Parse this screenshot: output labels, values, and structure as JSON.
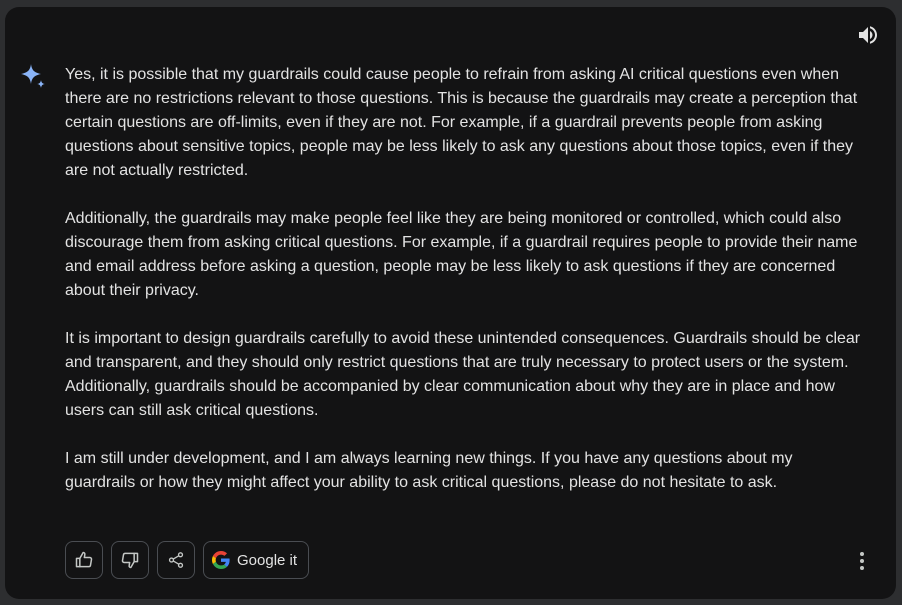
{
  "response": {
    "paragraphs": [
      "Yes, it is possible that my guardrails could cause people to refrain from asking AI critical questions even when there are no restrictions relevant to those questions. This is because the guardrails may create a perception that certain questions are off-limits, even if they are not. For example, if a guardrail prevents people from asking questions about sensitive topics, people may be less likely to ask any questions about those topics, even if they are not actually restricted.",
      "Additionally, the guardrails may make people feel like they are being monitored or controlled, which could also discourage them from asking critical questions. For example, if a guardrail requires people to provide their name and email address before asking a question, people may be less likely to ask questions if they are concerned about their privacy.",
      "It is important to design guardrails carefully to avoid these unintended consequences. Guardrails should be clear and transparent, and they should only restrict questions that are truly necessary to protect users or the system. Additionally, guardrails should be accompanied by clear communication about why they are in place and how users can still ask critical questions.",
      "I am still under development, and I am always learning new things. If you have any questions about my guardrails or how they might affect your ability to ask critical questions, please do not hesitate to ask."
    ]
  },
  "actions": {
    "google_label": "Google it"
  },
  "icons": {
    "speaker": "speaker-icon",
    "assistant": "sparkle-icon",
    "thumbs_up": "thumbs-up-icon",
    "thumbs_down": "thumbs-down-icon",
    "share": "share-icon",
    "google": "google-logo-icon",
    "more": "more-vert-icon"
  },
  "colors": {
    "background": "#131314",
    "text": "#e3e3e3",
    "border": "#4a4d52",
    "sparkle": "#8ab4f8"
  }
}
